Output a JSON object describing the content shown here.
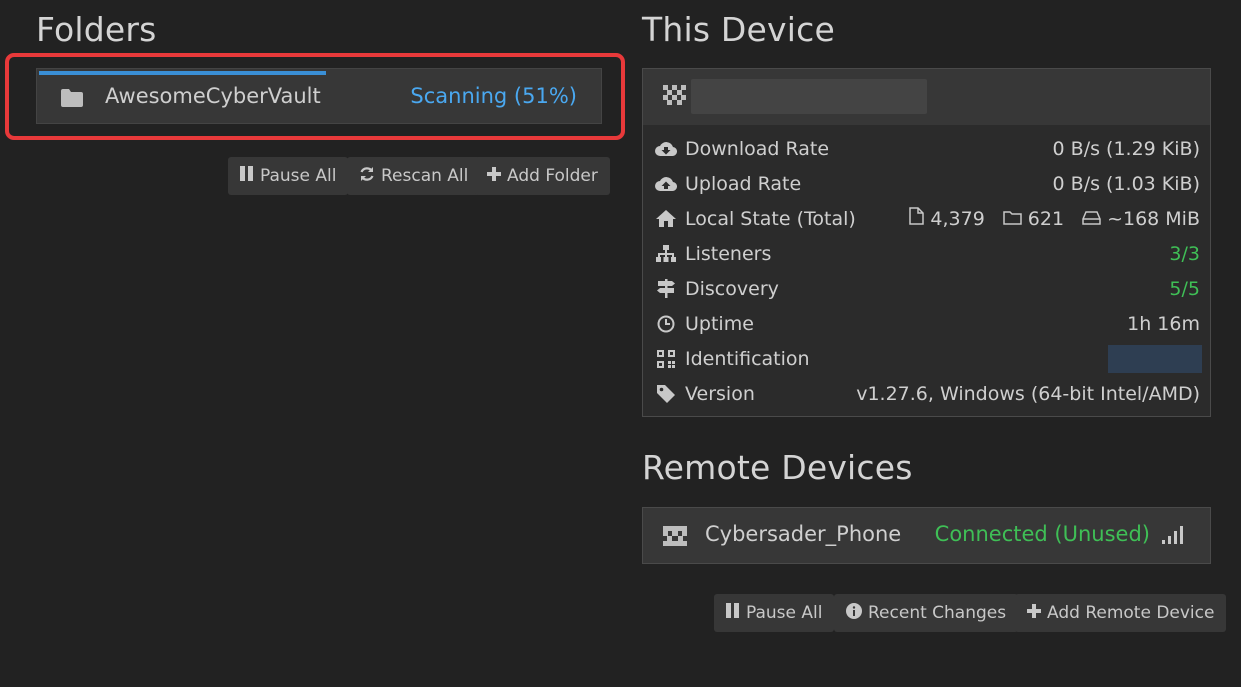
{
  "folders": {
    "heading": "Folders",
    "items": [
      {
        "name": "AwesomeCyberVault",
        "status": "Scanning (51%)",
        "progress_pct": 51
      }
    ],
    "buttons": {
      "pause_all": "Pause All",
      "rescan_all": "Rescan All",
      "add_folder": "Add Folder"
    }
  },
  "this_device": {
    "heading": "This Device",
    "rows": [
      {
        "icon": "cloud-download-icon",
        "label": "Download Rate",
        "value": "0 B/s (1.29 KiB)"
      },
      {
        "icon": "cloud-upload-icon",
        "label": "Upload Rate",
        "value": "0 B/s (1.03 KiB)"
      },
      {
        "icon": "home-icon",
        "label": "Local State (Total)",
        "files": "4,379",
        "folders": "621",
        "size": "~168 MiB"
      },
      {
        "icon": "sitemap-icon",
        "label": "Listeners",
        "value": "3/3"
      },
      {
        "icon": "signpost-icon",
        "label": "Discovery",
        "value": "5/5"
      },
      {
        "icon": "clock-icon",
        "label": "Uptime",
        "value": "1h 16m"
      },
      {
        "icon": "qrcode-icon",
        "label": "Identification"
      },
      {
        "icon": "tag-icon",
        "label": "Version",
        "value": "v1.27.6, Windows (64-bit Intel/AMD)"
      }
    ]
  },
  "remote_devices": {
    "heading": "Remote Devices",
    "items": [
      {
        "name": "Cybersader_Phone",
        "status": "Connected (Unused)"
      }
    ],
    "buttons": {
      "pause_all": "Pause All",
      "recent_changes": "Recent Changes",
      "add_remote": "Add Remote Device"
    }
  },
  "colors": {
    "accent_blue": "#4aa8f0",
    "status_green": "#3fbf56",
    "highlight_red": "#e8393a",
    "background": "#222222"
  }
}
